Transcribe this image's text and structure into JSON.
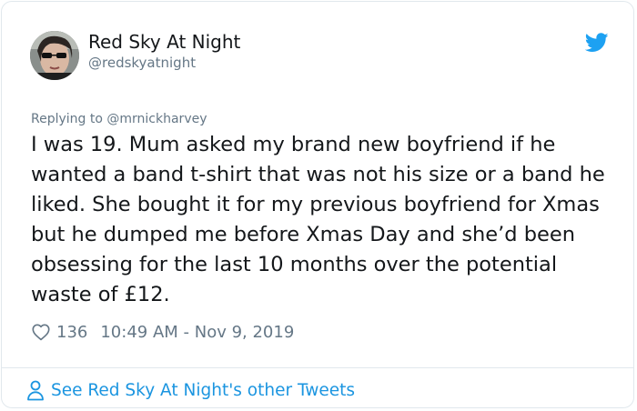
{
  "author": {
    "name": "Red Sky At Night",
    "handle": "@redskyatnight"
  },
  "reply": {
    "prefix": "Replying to ",
    "mention": "@mrnickharvey"
  },
  "tweet": {
    "text": "I was 19. Mum asked my brand new boyfriend if he wanted a band t-shirt that was not his size or a band he liked. She bought it for my previous boyfriend for Xmas but he dumped me before Xmas Day and she’d been obsessing for the last 10 months over the potential waste of £12.",
    "likes": "136",
    "timestamp": "10:49 AM - Nov 9, 2019"
  },
  "footer": {
    "link_label": "See Red Sky At Night's other Tweets"
  },
  "icons": {
    "logo": "twitter-bird-icon",
    "like": "heart-outline-icon",
    "profile": "person-outline-icon"
  },
  "colors": {
    "accent": "#1da1f2",
    "link": "#1b95e0",
    "muted": "#657786",
    "text": "#14171a",
    "border": "#e1e8ed"
  }
}
